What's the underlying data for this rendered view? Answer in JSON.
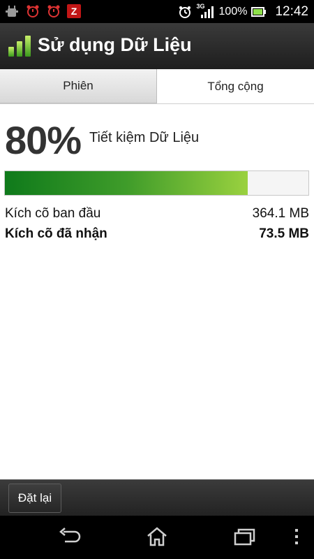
{
  "status_bar": {
    "left_icons": [
      "android-debug-icon",
      "alarm-icon",
      "alarm-icon",
      "z-app-icon"
    ],
    "z_label": "Z",
    "network": "3G",
    "battery_percent": "100%",
    "time": "12:42"
  },
  "app": {
    "title": "Sử dụng Dữ Liệu",
    "icon": "bar-chart-icon"
  },
  "tabs": [
    {
      "label": "Phiên",
      "active": false
    },
    {
      "label": "Tổng cộng",
      "active": true
    }
  ],
  "summary": {
    "savings_percent": "80%",
    "savings_label": "Tiết kiệm Dữ Liệu",
    "progress_fraction": 0.8
  },
  "sizes": {
    "original_label": "Kích cõ ban đầu",
    "original_value": "364.1 MB",
    "received_label": "Kích cõ đã nhận",
    "received_value": "73.5 MB"
  },
  "actions": {
    "reset_label": "Đặt lại"
  },
  "navigation": {
    "buttons": [
      "back-icon",
      "home-icon",
      "recent-apps-icon",
      "overflow-menu-icon"
    ]
  },
  "colors": {
    "progress_start": "#0f7a1b",
    "progress_end": "#9ad13f",
    "z_app_red": "#c21616"
  }
}
